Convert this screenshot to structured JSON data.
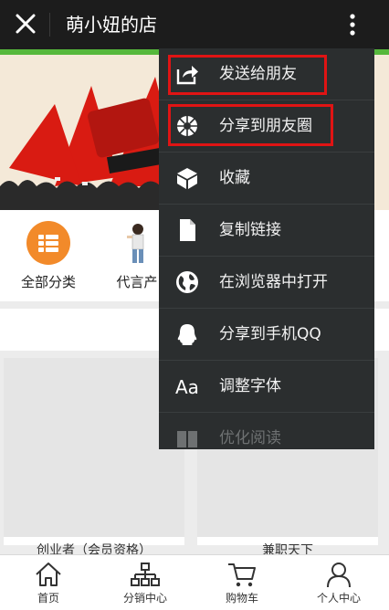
{
  "header": {
    "title": "萌小妞的店",
    "close_icon": "close-icon",
    "more_icon": "more-vertical-icon"
  },
  "categories": [
    {
      "label": "全部分类",
      "icon": "list-icon"
    },
    {
      "label": "代言产",
      "icon": "person-photo"
    }
  ],
  "products": [
    {
      "name": "创业者（会员资格）"
    },
    {
      "name": "兼职天下"
    }
  ],
  "menu": {
    "items": [
      {
        "label": "发送给朋友",
        "icon": "share-arrow-icon",
        "highlighted": true
      },
      {
        "label": "分享到朋友圈",
        "icon": "moments-icon",
        "highlighted": true
      },
      {
        "label": "收藏",
        "icon": "cube-icon"
      },
      {
        "label": "复制链接",
        "icon": "document-icon"
      },
      {
        "label": "在浏览器中打开",
        "icon": "globe-icon"
      },
      {
        "label": "分享到手机QQ",
        "icon": "qq-icon"
      },
      {
        "label": "调整字体",
        "icon": "font-icon"
      },
      {
        "label": "优化阅读",
        "icon": "book-icon"
      }
    ],
    "highlight_color": "#e01414"
  },
  "tabbar": {
    "items": [
      {
        "label": "首页",
        "icon": "home-icon"
      },
      {
        "label": "分销中心",
        "icon": "org-chart-icon"
      },
      {
        "label": "购物车",
        "icon": "cart-icon"
      },
      {
        "label": "个人中心",
        "icon": "user-icon"
      }
    ]
  }
}
